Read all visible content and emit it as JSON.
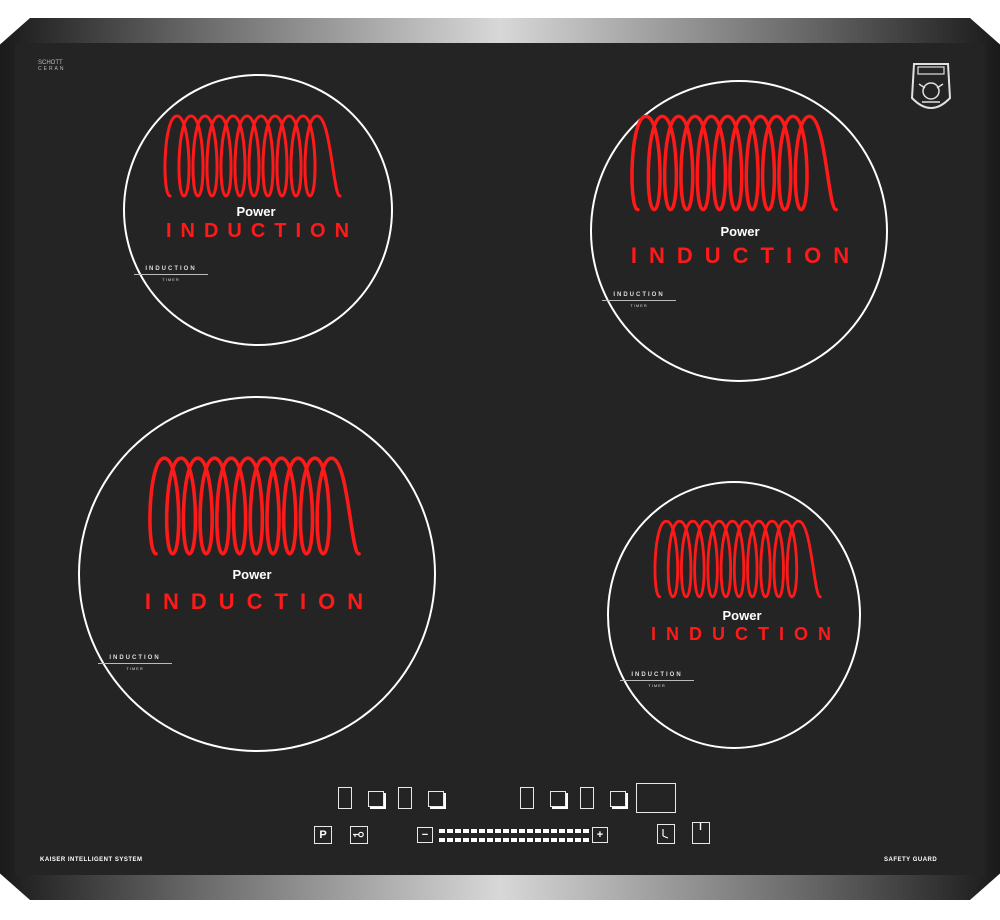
{
  "brand": {
    "line1": "SCHOTT",
    "line2": "CERAN"
  },
  "zones": [
    {
      "id": "rear-left",
      "power": "Power",
      "induction": "INDUCTION",
      "timer_title": "INDUCTION",
      "timer_sub": "TIMER"
    },
    {
      "id": "rear-right",
      "power": "Power",
      "induction": "INDUCTION",
      "timer_title": "INDUCTION",
      "timer_sub": "TIMER"
    },
    {
      "id": "front-left",
      "power": "Power",
      "induction": "INDUCTION",
      "timer_title": "INDUCTION",
      "timer_sub": "TIMER"
    },
    {
      "id": "front-right",
      "power": "Power",
      "induction": "INDUCTION",
      "timer_title": "INDUCTION",
      "timer_sub": "TIMER"
    }
  ],
  "controls": {
    "pause_label": "P",
    "minus_label": "−",
    "plus_label": "+"
  },
  "footer": {
    "left": "KAISER INTELLIGENT SYSTEM",
    "right": "SAFETY GUARD"
  },
  "colors": {
    "coil": "#ff1a1a",
    "glass": "#242424",
    "outline": "#ffffff"
  }
}
